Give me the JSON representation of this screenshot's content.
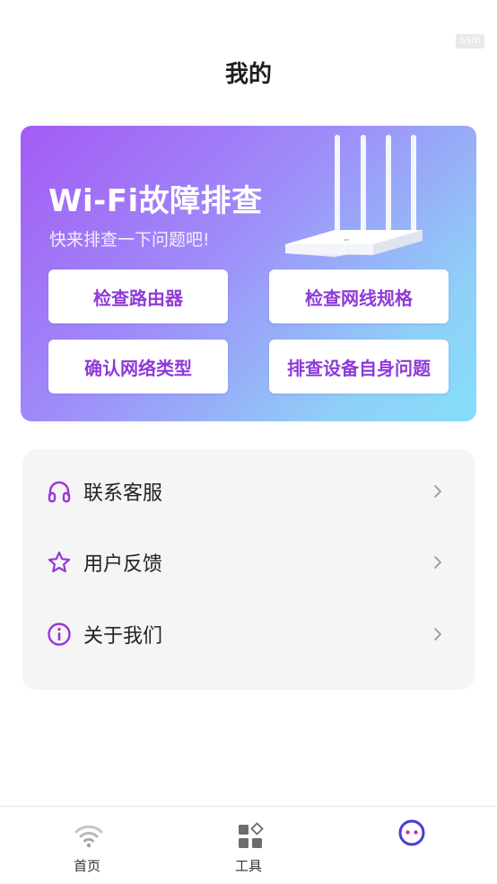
{
  "corner_tag": "b5rb",
  "header": {
    "title": "我的"
  },
  "banner": {
    "title": "Wi-Fi故障排查",
    "subtitle": "快来排查一下问题吧!",
    "buttons": [
      {
        "label": "检查路由器"
      },
      {
        "label": "检查网线规格"
      },
      {
        "label": "确认网络类型"
      },
      {
        "label": "排查设备自身问题"
      }
    ],
    "gradient_colors": [
      "#a35bf4",
      "#9f8bf9",
      "#8fcff8",
      "#86def9"
    ]
  },
  "menu": {
    "items": [
      {
        "label": "联系客服",
        "icon": "headphones-icon"
      },
      {
        "label": "用户反馈",
        "icon": "star-icon"
      },
      {
        "label": "关于我们",
        "icon": "info-icon"
      }
    ]
  },
  "tabbar": {
    "tabs": [
      {
        "label": "首页",
        "icon": "wifi-icon",
        "active": false
      },
      {
        "label": "工具",
        "icon": "grid-icon",
        "active": false
      },
      {
        "label": "",
        "icon": "face-icon",
        "active": true
      }
    ]
  },
  "colors": {
    "accent": "#8f3ad8",
    "menu_bg": "#f5f5f5"
  }
}
